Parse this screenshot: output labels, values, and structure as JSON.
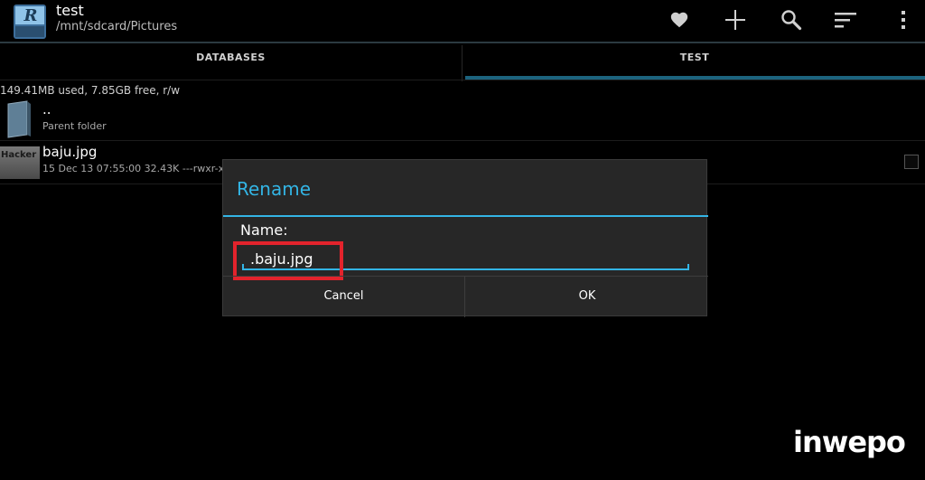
{
  "actionbar": {
    "title": "test",
    "subtitle": "/mnt/sdcard/Pictures",
    "icons": [
      "heart-icon",
      "plus-icon",
      "search-icon",
      "sort-icon",
      "overflow-menu-icon"
    ]
  },
  "tabs": [
    {
      "label": "DATABASES"
    },
    {
      "label": "TEST",
      "selected": true
    }
  ],
  "storage": "149.41MB used, 7.85GB free, r/w",
  "list": {
    "parent": {
      "name": "..",
      "sub": "Parent folder"
    },
    "file": {
      "name": "baju.jpg",
      "thumb_text": "Hacker",
      "sub": "15 Dec 13 07:55:00  32.43K  ---rwxr-x"
    }
  },
  "dialog": {
    "title": "Rename",
    "label": "Name:",
    "value": ".baju.jpg",
    "cancel": "Cancel",
    "ok": "OK"
  },
  "watermark": "inwepo",
  "colors": {
    "accent": "#33b5e5",
    "highlight": "#e3232c"
  }
}
